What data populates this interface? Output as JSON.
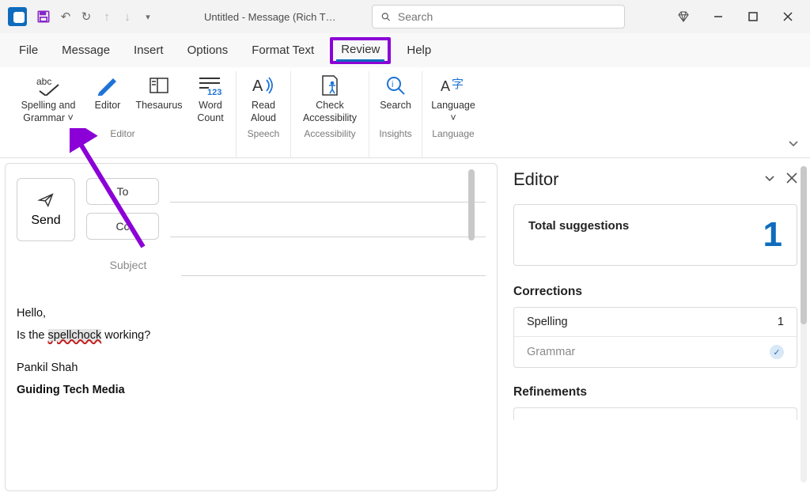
{
  "titlebar": {
    "window_title": "Untitled  -  Message (Rich T…",
    "search_placeholder": "Search"
  },
  "menubar": {
    "items": [
      "File",
      "Message",
      "Insert",
      "Options",
      "Format Text",
      "Review",
      "Help"
    ],
    "active_index": 5
  },
  "ribbon": {
    "groups": [
      {
        "label": "Editor",
        "items": [
          {
            "label": "Spelling and Grammar ˅",
            "icon": "spelling-icon"
          },
          {
            "label": "Editor",
            "icon": "editor-icon"
          },
          {
            "label": "Thesaurus",
            "icon": "thesaurus-icon"
          },
          {
            "label": "Word Count",
            "icon": "wordcount-icon"
          }
        ]
      },
      {
        "label": "Speech",
        "items": [
          {
            "label": "Read Aloud",
            "icon": "readaloud-icon"
          }
        ]
      },
      {
        "label": "Accessibility",
        "items": [
          {
            "label": "Check Accessibility",
            "icon": "accessibility-icon"
          }
        ]
      },
      {
        "label": "Insights",
        "items": [
          {
            "label": "Search",
            "icon": "search-tool-icon"
          }
        ]
      },
      {
        "label": "Language",
        "items": [
          {
            "label": "Language ˅",
            "icon": "language-icon"
          }
        ]
      }
    ]
  },
  "compose": {
    "send_label": "Send",
    "to_label": "To",
    "cc_label": "Cc",
    "subject_label": "Subject",
    "body": {
      "line1": "Hello,",
      "line2a": "Is the ",
      "miss": "spellchock",
      "line2b": " working?",
      "sig1": "Pankil Shah",
      "sig2": "Guiding Tech Media"
    }
  },
  "editor": {
    "title": "Editor",
    "total_label": "Total suggestions",
    "total_value": "1",
    "corrections_label": "Corrections",
    "spelling_label": "Spelling",
    "spelling_count": "1",
    "grammar_label": "Grammar",
    "refinements_label": "Refinements"
  }
}
